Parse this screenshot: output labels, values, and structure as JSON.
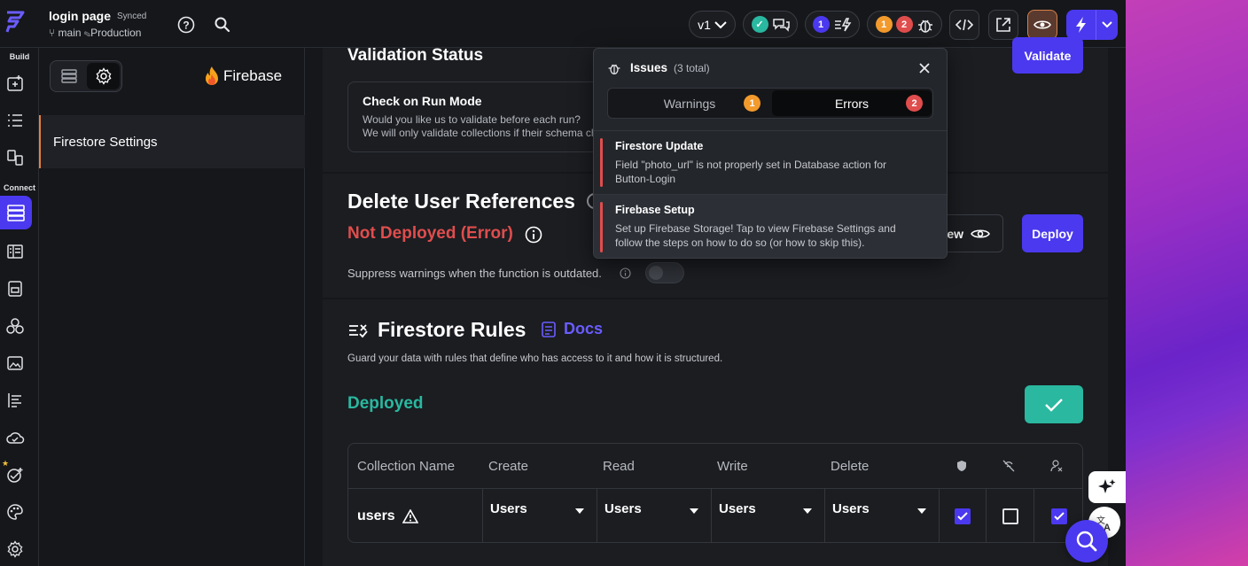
{
  "topbar": {
    "project_title": "login page",
    "sync_status": "Synced",
    "branch": "main",
    "environment": "Production",
    "version": "v1",
    "agents_count": "1",
    "warnings_count": "1",
    "errors_count": "2"
  },
  "leftnav": {
    "build_label": "Build",
    "connect_label": "Connect"
  },
  "panel": {
    "brand": "Firebase",
    "selected_item": "Firestore Settings"
  },
  "validation": {
    "title": "Validation Status",
    "validate_button": "Validate",
    "card_title": "Check on Run Mode",
    "card_desc_1": "Would you like us to validate before each run?",
    "card_desc_2": "We will only validate collections if their schema cha"
  },
  "delete_refs": {
    "title": "Delete User References",
    "status": "Not Deployed (Error)",
    "view_label": "ew",
    "deploy_button": "Deploy",
    "suppress_label": "Suppress warnings when the function is outdated."
  },
  "rules": {
    "title": "Firestore Rules",
    "docs_label": "Docs",
    "description": "Guard your data with rules that define who has access to it and how it is structured.",
    "status": "Deployed",
    "columns": [
      "Collection Name",
      "Create",
      "Read",
      "Write",
      "Delete"
    ],
    "row": {
      "name": "users",
      "create": "Users",
      "read": "Users",
      "write": "Users",
      "delete": "Users",
      "check1": true,
      "check2": false,
      "check3": true
    }
  },
  "issues": {
    "title": "Issues",
    "total": "(3 total)",
    "warnings_tab": "Warnings",
    "warnings_count": "1",
    "errors_tab": "Errors",
    "errors_count": "2",
    "items": [
      {
        "title": "Firestore Update",
        "description": "Field \"photo_url\" is not properly set in Database action for Button-Login"
      },
      {
        "title": "Firebase Setup",
        "description": "Set up Firebase Storage! Tap to view Firebase Settings and follow the steps on how to do so (or how to skip this)."
      }
    ]
  },
  "colors": {
    "accent": "#4b39ef",
    "teal": "#2ab8a0",
    "error": "#e04d4d",
    "warning": "#f39a2c"
  }
}
